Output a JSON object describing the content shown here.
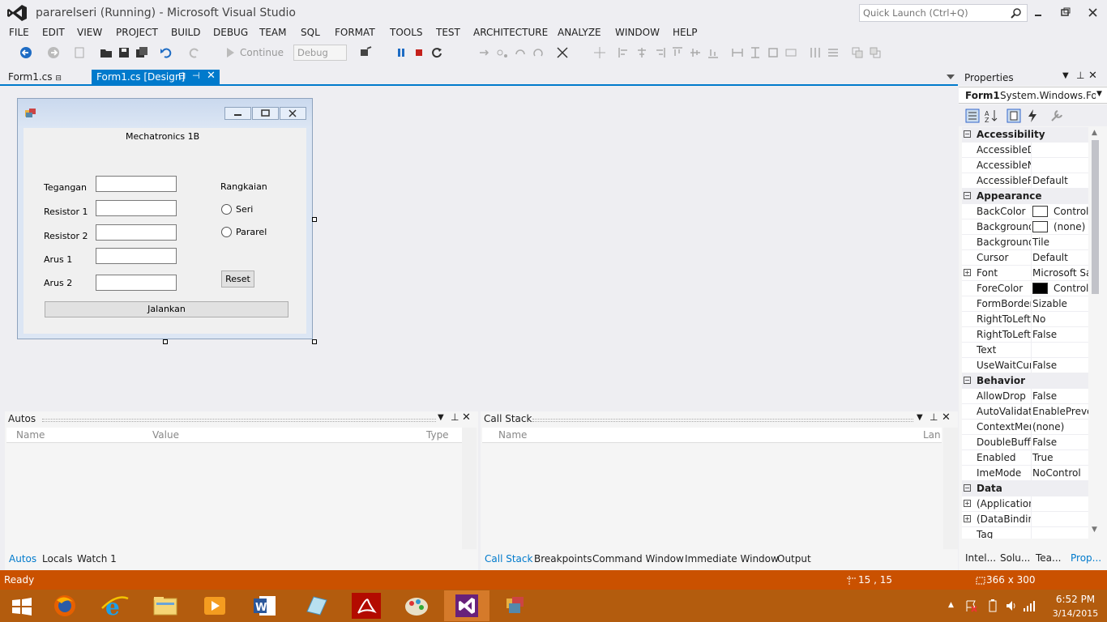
{
  "window": {
    "title": "pararelseri (Running) - Microsoft Visual Studio"
  },
  "quick_launch": {
    "placeholder": "Quick Launch (Ctrl+Q)"
  },
  "menu": [
    "FILE",
    "EDIT",
    "VIEW",
    "PROJECT",
    "BUILD",
    "DEBUG",
    "TEAM",
    "SQL",
    "FORMAT",
    "TOOLS",
    "TEST",
    "ARCHITECTURE",
    "ANALYZE",
    "WINDOW",
    "HELP"
  ],
  "toolbar": {
    "continue_label": "Continue",
    "config_value": "Debug"
  },
  "doc_tabs": {
    "tab1": "Form1.cs",
    "tab2": "Form1.cs [Design]"
  },
  "form": {
    "heading": "Mechatronics 1B",
    "labels": {
      "tegangan": "Tegangan",
      "resistor1": "Resistor 1",
      "resistor2": "Resistor 2",
      "arus1": "Arus 1",
      "arus2": "Arus 2"
    },
    "group_label": "Rangkaian",
    "radio_seri": "Seri",
    "radio_pararel": "Pararel",
    "reset_button": "Reset",
    "run_button": "Jalankan"
  },
  "properties": {
    "title": "Properties",
    "object_name": "Form1",
    "object_type": "System.Windows.For",
    "rows": [
      {
        "type": "cat",
        "name": "Accessibility"
      },
      {
        "name": "AccessibleD",
        "value": ""
      },
      {
        "name": "AccessibleN",
        "value": ""
      },
      {
        "name": "AccessibleR",
        "value": "Default"
      },
      {
        "type": "cat",
        "name": "Appearance"
      },
      {
        "name": "BackColor",
        "value": "Control",
        "swatch": "#ffffff"
      },
      {
        "name": "Background",
        "value": "(none)",
        "swatch": "#ffffff"
      },
      {
        "name": "Background",
        "value": "Tile"
      },
      {
        "name": "Cursor",
        "value": "Default"
      },
      {
        "name": "Font",
        "value": "Microsoft Sa",
        "expand": true
      },
      {
        "name": "ForeColor",
        "value": "ControlT",
        "swatch": "#000000"
      },
      {
        "name": "FormBorder",
        "value": "Sizable"
      },
      {
        "name": "RightToLeft",
        "value": "No"
      },
      {
        "name": "RightToLeftl",
        "value": "False"
      },
      {
        "name": "Text",
        "value": ""
      },
      {
        "name": "UseWaitCurs",
        "value": "False"
      },
      {
        "type": "cat",
        "name": "Behavior"
      },
      {
        "name": "AllowDrop",
        "value": "False"
      },
      {
        "name": "AutoValidate",
        "value": "EnablePrever"
      },
      {
        "name": "ContextMen",
        "value": "(none)"
      },
      {
        "name": "DoubleBuffe",
        "value": "False"
      },
      {
        "name": "Enabled",
        "value": "True"
      },
      {
        "name": "ImeMode",
        "value": "NoControl"
      },
      {
        "type": "cat",
        "name": "Data"
      },
      {
        "name": "(Application",
        "value": "",
        "expand": true
      },
      {
        "name": "(DataBinding",
        "value": "",
        "expand": true
      },
      {
        "name": "Tag",
        "value": ""
      }
    ],
    "bottom_tabs": [
      "Intel...",
      "Solu...",
      "Tea...",
      "Prop..."
    ]
  },
  "autos": {
    "title": "Autos",
    "columns": [
      "Name",
      "Value",
      "Type"
    ],
    "tabs": [
      "Autos",
      "Locals",
      "Watch 1"
    ]
  },
  "callstack": {
    "title": "Call Stack",
    "columns": [
      "Name",
      "Lang"
    ],
    "tabs": [
      "Call Stack",
      "Breakpoints",
      "Command Window",
      "Immediate Window",
      "Output"
    ]
  },
  "status": {
    "text": "Ready",
    "position": "15 , 15",
    "size": "366 x 300"
  },
  "taskbar": {
    "time": "6:52 PM",
    "date": "3/14/2015"
  },
  "colors": {
    "accent": "#007acc",
    "status_bar": "#ca5100",
    "taskbar": "#b35c0e"
  }
}
